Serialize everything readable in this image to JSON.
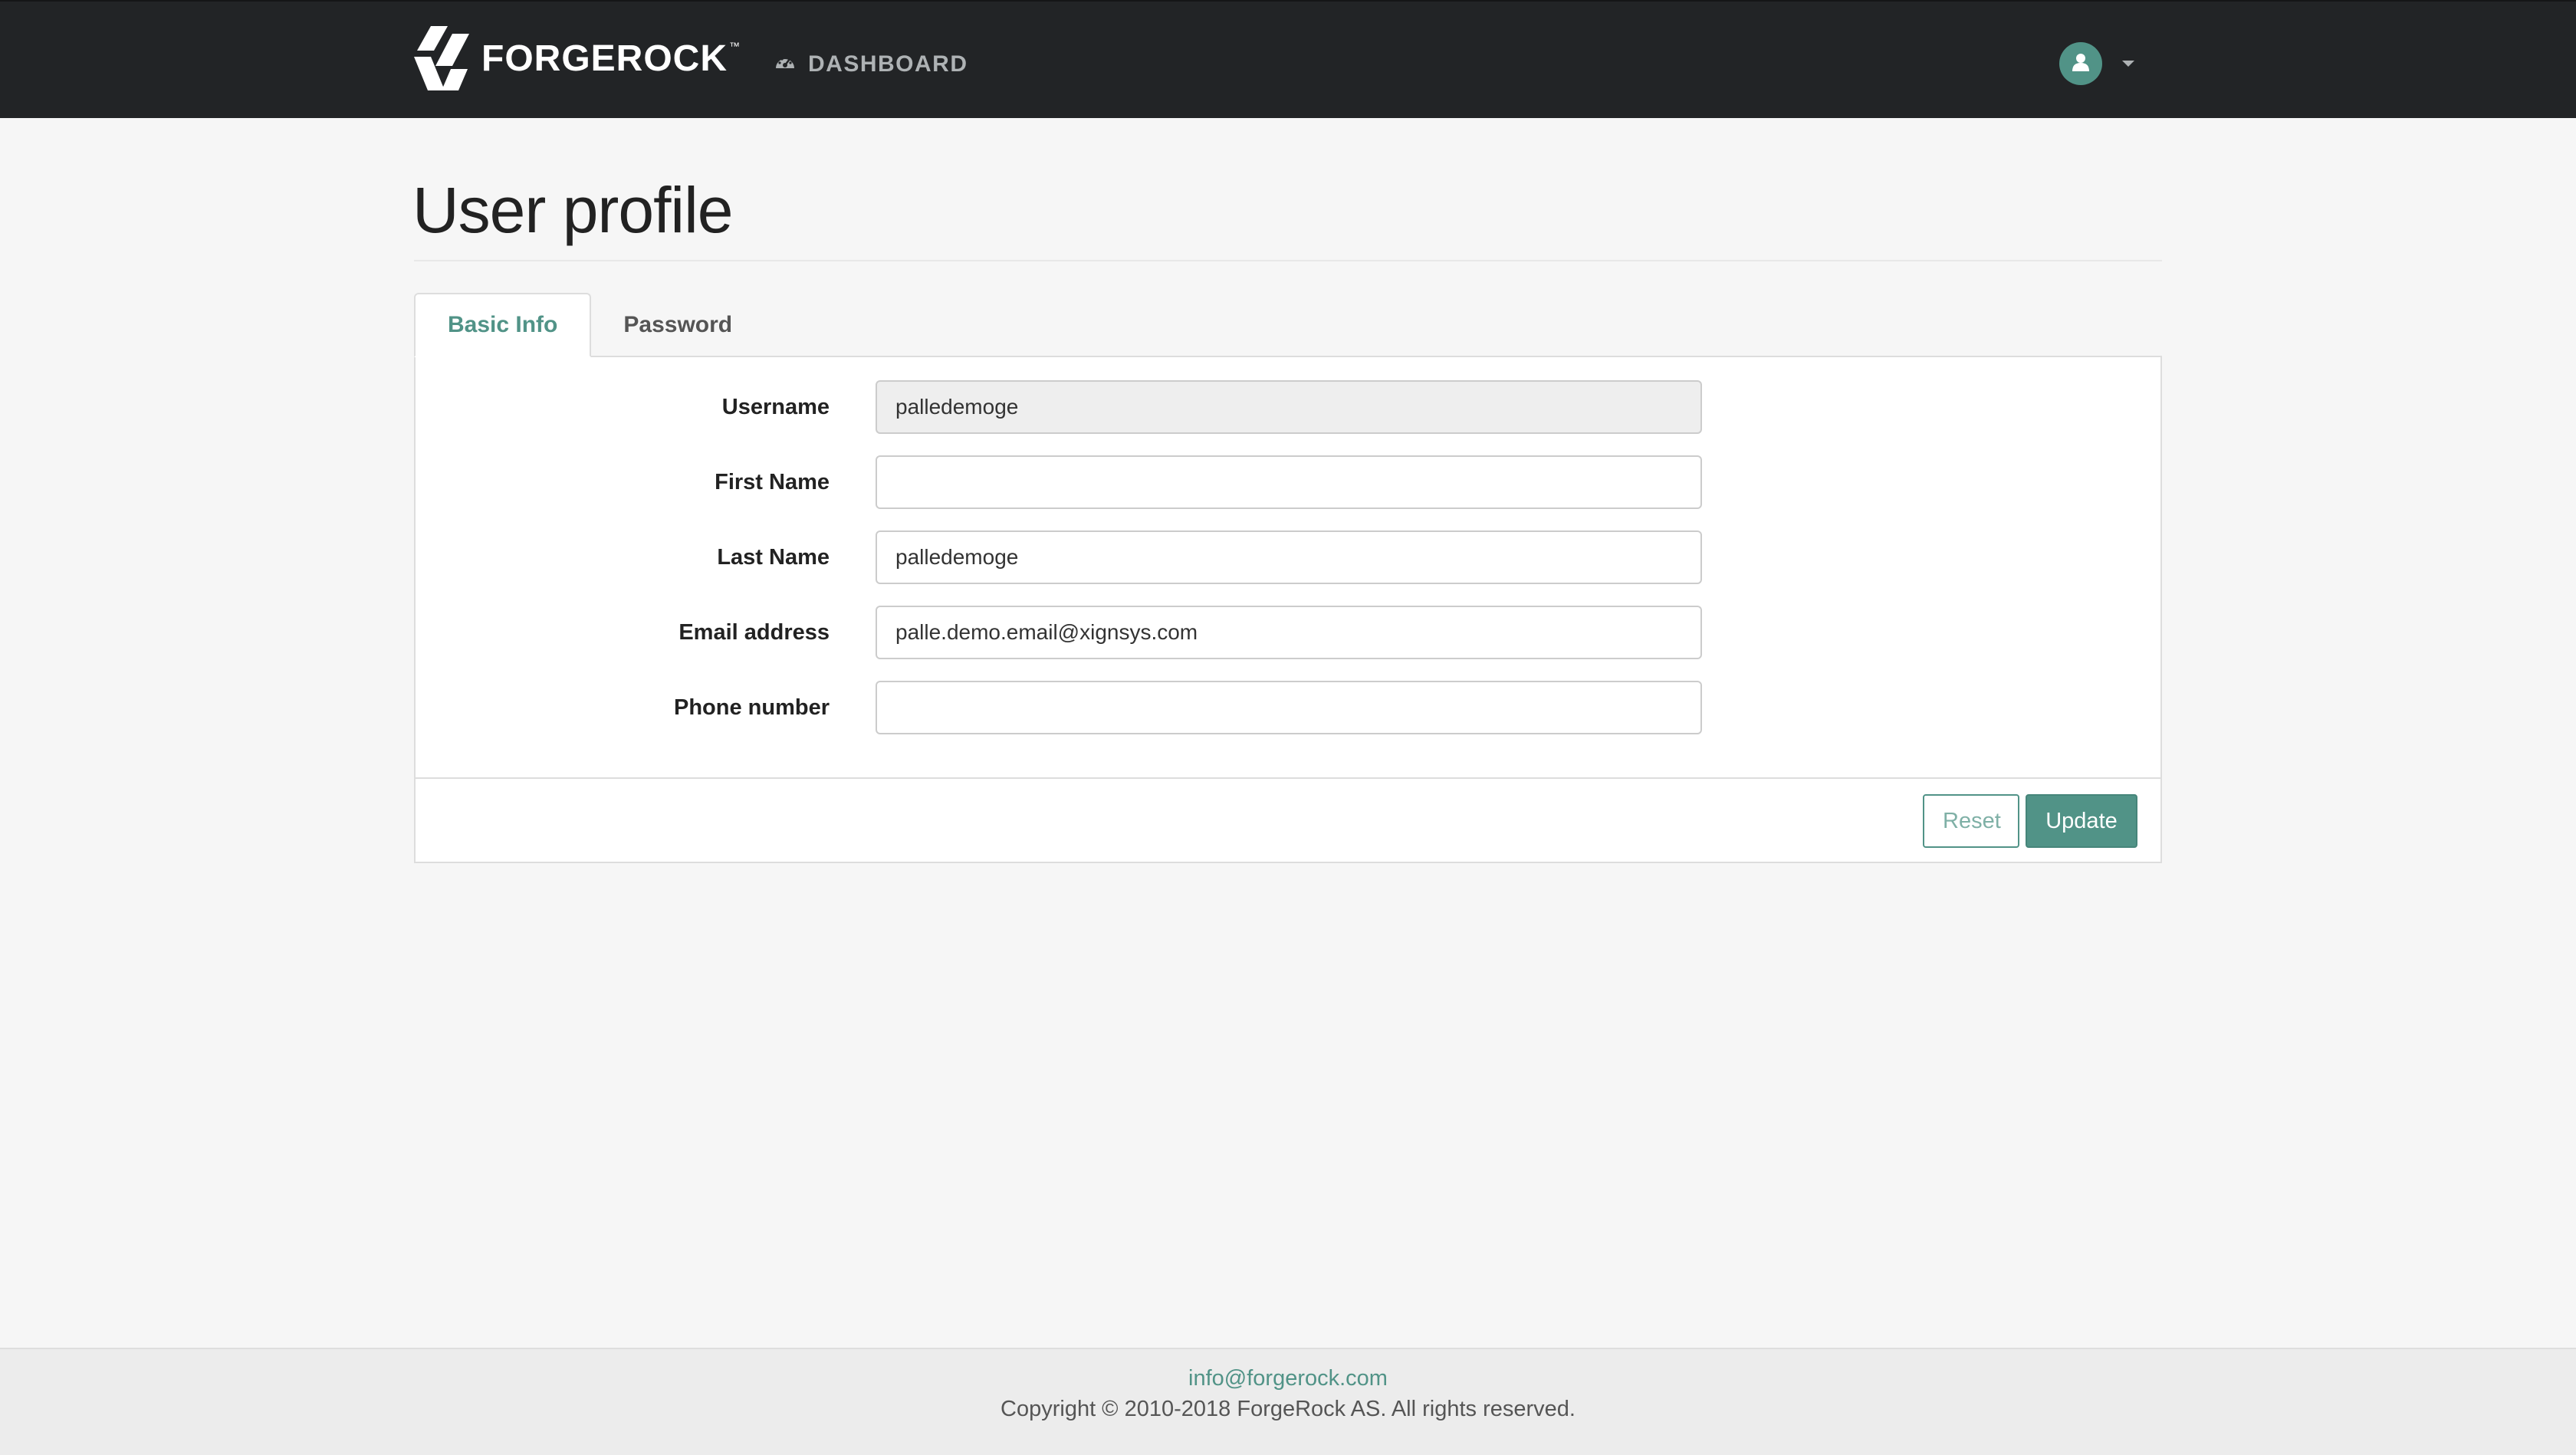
{
  "colors": {
    "navbar_bg": "#222426",
    "accent": "#519387",
    "page_bg": "#f6f6f6"
  },
  "header": {
    "brand": "FORGEROCK",
    "brand_mark": "™",
    "nav_dashboard": "DASHBOARD",
    "icons": [
      "forgerock-logo-icon",
      "dashboard-gauge-icon",
      "user-icon",
      "caret-down-icon"
    ]
  },
  "main": {
    "title": "User profile",
    "tabs": [
      {
        "label": "Basic Info",
        "active": true
      },
      {
        "label": "Password",
        "active": false
      }
    ],
    "form": {
      "fields": [
        {
          "label": "Username",
          "value": "palledemoge",
          "readonly": true
        },
        {
          "label": "First Name",
          "value": "",
          "readonly": false
        },
        {
          "label": "Last Name",
          "value": "palledemoge",
          "readonly": false
        },
        {
          "label": "Email address",
          "value": "palle.demo.email@xignsys.com",
          "readonly": false
        },
        {
          "label": "Phone number",
          "value": "",
          "readonly": false
        }
      ]
    },
    "buttons": {
      "reset": "Reset",
      "update": "Update"
    }
  },
  "footer": {
    "email": "info@forgerock.com",
    "copyright": "Copyright © 2010-2018 ForgeRock AS. All rights reserved."
  }
}
